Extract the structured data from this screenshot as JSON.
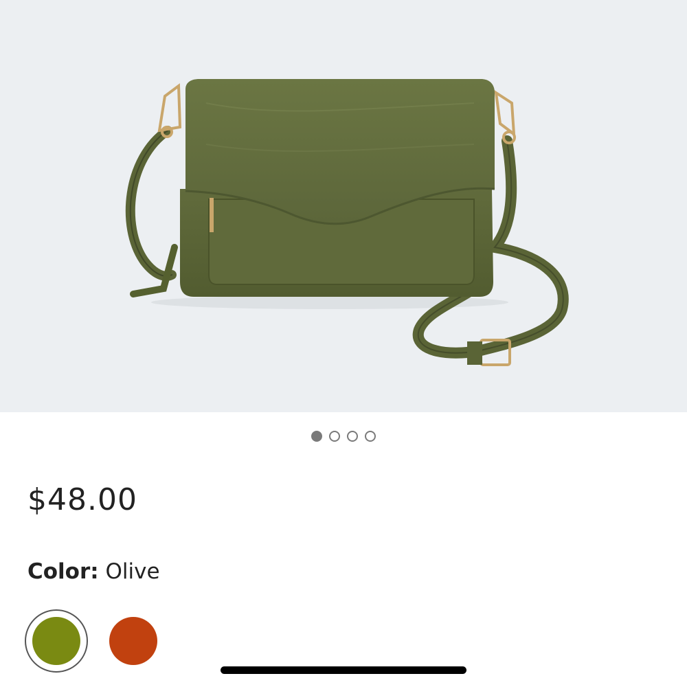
{
  "product": {
    "price": "$48.00",
    "image_name": "olive crossbody bag"
  },
  "gallery": {
    "dots": [
      {
        "active": true
      },
      {
        "active": false
      },
      {
        "active": false
      },
      {
        "active": false
      }
    ]
  },
  "color": {
    "label": "Color:",
    "selected_value": "Olive",
    "swatches": [
      {
        "color": "#7a8a12",
        "selected": true
      },
      {
        "color": "#c1410f",
        "selected": false
      }
    ]
  },
  "theme": {
    "hero_background": "#eceff2",
    "text": "#222222",
    "dot": "#7a7a7a"
  }
}
